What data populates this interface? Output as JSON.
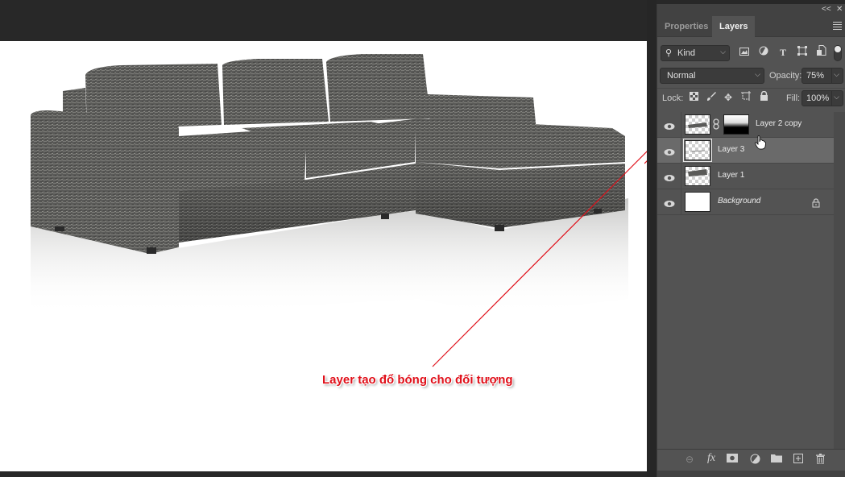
{
  "panel": {
    "collapse_label": "<<",
    "close_label": "✕",
    "tabs": [
      {
        "label": "Properties",
        "active": false
      },
      {
        "label": "Layers",
        "active": true
      }
    ],
    "filter": {
      "kind_label": "Kind",
      "icons": [
        "image-filter-icon",
        "adjustment-filter-icon",
        "type-filter-icon",
        "shape-filter-icon",
        "smart-object-filter-icon",
        "filter-toggle-icon"
      ]
    },
    "blend_mode": "Normal",
    "opacity_label": "Opacity:",
    "opacity_value": "75%",
    "lock_label": "Lock:",
    "fill_label": "Fill:",
    "fill_value": "100%",
    "layers": [
      {
        "name": "Layer 2 copy",
        "visible": true,
        "selected": false,
        "has_mask": true,
        "italic": false,
        "locked": false
      },
      {
        "name": "Layer 3",
        "visible": true,
        "selected": true,
        "has_mask": false,
        "italic": false,
        "locked": false
      },
      {
        "name": "Layer 1",
        "visible": true,
        "selected": false,
        "has_mask": false,
        "italic": false,
        "locked": false
      },
      {
        "name": "Background",
        "visible": true,
        "selected": false,
        "has_mask": false,
        "italic": true,
        "locked": true
      }
    ],
    "footer_icons": [
      "link-layers-icon",
      "fx-icon",
      "add-mask-icon",
      "adjustment-layer-icon",
      "new-group-icon",
      "new-layer-icon",
      "delete-layer-icon"
    ],
    "fx_label": "fx"
  },
  "canvas": {
    "annotation": "Layer tạo đổ bóng cho đối tượng",
    "annotation_color": "#e0101a"
  }
}
